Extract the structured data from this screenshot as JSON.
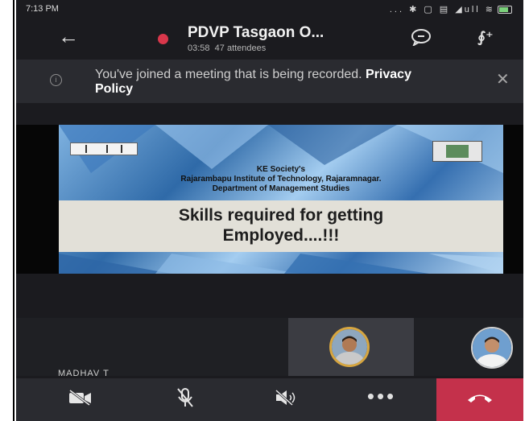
{
  "status_bar": {
    "time": "7:13 PM",
    "icons_text": "... ✱ ▢ ▤ ◢ull ≋"
  },
  "meeting": {
    "title": "PDVP Tasgaon O...",
    "duration": "03:58",
    "attendees": "47 attendees"
  },
  "banner": {
    "message": "You've joined a meeting that is being recorded.",
    "link": "Privacy Policy"
  },
  "slide": {
    "society": "KE Society's",
    "institute": "Rajarambapu Institute of Technology, Rajaramnagar.",
    "department": "Department of Management Studies",
    "headline_line1": "Skills required for getting",
    "headline_line2": "Employed....!!!"
  },
  "participant": {
    "name": "MADHAV T"
  },
  "icons": {
    "back": "arrow-left-icon",
    "record": "recording-dot-icon",
    "chat": "chat-icon",
    "people": "people-add-icon",
    "info": "info-icon",
    "close": "close-icon",
    "video": "video-off-icon",
    "mic": "mic-off-icon",
    "speaker": "speaker-off-icon",
    "more": "more-icon",
    "hangup": "hang-up-icon"
  },
  "colors": {
    "background": "#1b1b1f",
    "banner": "#2a2b30",
    "recording": "#d9374b",
    "hangup": "#c4314b",
    "avatar_ring": "#d7a640"
  }
}
